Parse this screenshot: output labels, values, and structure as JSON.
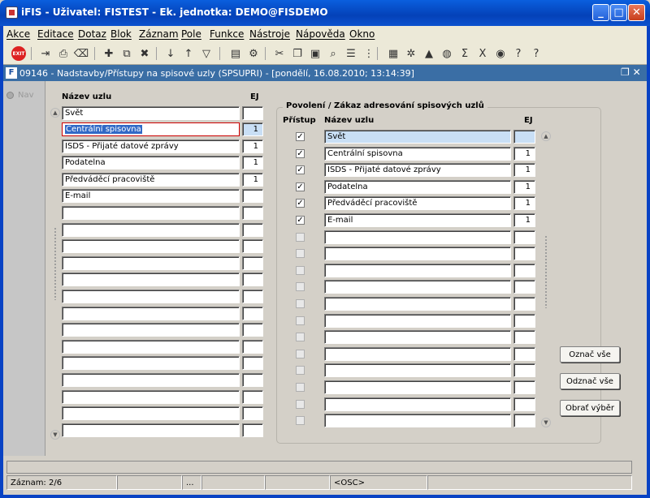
{
  "window": {
    "title": "iFIS - Uživatel: FISTEST - Ek. jednotka: DEMO@FISDEMO"
  },
  "menu": [
    "Akce",
    "Editace",
    "Dotaz",
    "Blok",
    "Záznam",
    "Pole",
    "Funkce",
    "Nástroje",
    "Nápověda",
    "Okno"
  ],
  "toolbar": {
    "exit_label": "EXIT",
    "icons": [
      "exit-icon",
      "save-icon",
      "print-preview-icon",
      "delete-icon",
      "insert-record-icon",
      "duplicate-record-icon",
      "delete-record-icon",
      "sort-asc-icon",
      "sort-desc-icon",
      "filter-icon",
      "print-icon",
      "print-setup-icon",
      "cut-icon",
      "copy-icon",
      "paste-icon",
      "search-icon",
      "list-icon",
      "tree-icon",
      "calculator-icon",
      "settings-icon",
      "warning-icon",
      "disk-icon",
      "sum-icon",
      "excel-icon",
      "globe-icon",
      "help-search-icon",
      "help-icon"
    ]
  },
  "form": {
    "title": "09146 - Nadstavby/Přístupy na spisové uzly (SPSUPRI) - [pondělí, 16.08.2010; 13:14:39]",
    "nav_label": "Nav"
  },
  "left": {
    "col_name": "Název uzlu",
    "col_ej": "EJ",
    "header_name": "Svět",
    "header_ej": "",
    "rows": [
      {
        "name": "Centrální spisovna",
        "ej": "1"
      },
      {
        "name": "ISDS - Přijaté datové zprávy",
        "ej": "1"
      },
      {
        "name": "Podatelna",
        "ej": "1"
      },
      {
        "name": "Předváděcí pracoviště",
        "ej": "1"
      },
      {
        "name": "E-mail",
        "ej": ""
      },
      {
        "name": "",
        "ej": ""
      },
      {
        "name": "",
        "ej": ""
      },
      {
        "name": "",
        "ej": ""
      },
      {
        "name": "",
        "ej": ""
      },
      {
        "name": "",
        "ej": ""
      },
      {
        "name": "",
        "ej": ""
      },
      {
        "name": "",
        "ej": ""
      },
      {
        "name": "",
        "ej": ""
      },
      {
        "name": "",
        "ej": ""
      },
      {
        "name": "",
        "ej": ""
      },
      {
        "name": "",
        "ej": ""
      },
      {
        "name": "",
        "ej": ""
      },
      {
        "name": "",
        "ej": ""
      },
      {
        "name": "",
        "ej": ""
      }
    ]
  },
  "right": {
    "group_title": "Povolení / Zákaz adresování spisových uzlů",
    "col_access": "Přístup",
    "col_name": "Název uzlu",
    "col_ej": "EJ",
    "rows": [
      {
        "checked": true,
        "name": "Svět",
        "ej": ""
      },
      {
        "checked": true,
        "name": "Centrální spisovna",
        "ej": "1"
      },
      {
        "checked": true,
        "name": "ISDS - Přijaté datové zprávy",
        "ej": "1"
      },
      {
        "checked": true,
        "name": "Podatelna",
        "ej": "1"
      },
      {
        "checked": true,
        "name": "Předváděcí pracoviště",
        "ej": "1"
      },
      {
        "checked": true,
        "name": "E-mail",
        "ej": "1"
      },
      {
        "checked": false,
        "name": "",
        "ej": ""
      },
      {
        "checked": false,
        "name": "",
        "ej": ""
      },
      {
        "checked": false,
        "name": "",
        "ej": ""
      },
      {
        "checked": false,
        "name": "",
        "ej": ""
      },
      {
        "checked": false,
        "name": "",
        "ej": ""
      },
      {
        "checked": false,
        "name": "",
        "ej": ""
      },
      {
        "checked": false,
        "name": "",
        "ej": ""
      },
      {
        "checked": false,
        "name": "",
        "ej": ""
      },
      {
        "checked": false,
        "name": "",
        "ej": ""
      },
      {
        "checked": false,
        "name": "",
        "ej": ""
      },
      {
        "checked": false,
        "name": "",
        "ej": ""
      },
      {
        "checked": false,
        "name": "",
        "ej": ""
      }
    ]
  },
  "buttons": {
    "select_all": "Označ vše",
    "deselect_all": "Odznač vše",
    "invert": "Obrať výběr"
  },
  "status": {
    "record": "Záznam: 2/6",
    "dots": "...",
    "mode": "<OSC>"
  }
}
